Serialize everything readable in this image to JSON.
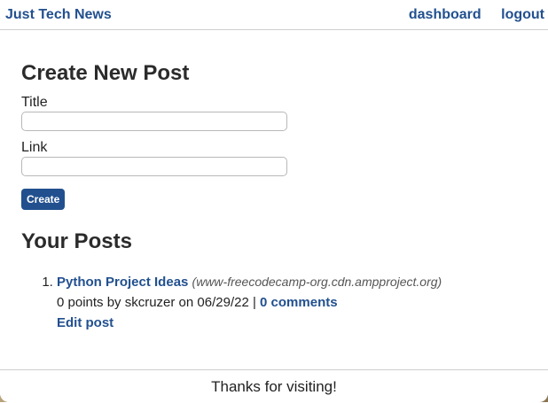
{
  "header": {
    "site_title": "Just Tech News",
    "nav": {
      "dashboard": "dashboard",
      "logout": "logout"
    }
  },
  "create_form": {
    "heading": "Create New Post",
    "title_label": "Title",
    "title_value": "",
    "link_label": "Link",
    "link_value": "",
    "submit_label": "Create"
  },
  "posts": {
    "heading": "Your Posts",
    "items": [
      {
        "title": "Python Project Ideas",
        "url": "(www-freecodecamp-org.cdn.ampproject.org)",
        "meta_prefix": "0 points by skcruzer on 06/29/22 |",
        "comments": "0 comments",
        "edit": "Edit post"
      }
    ]
  },
  "footer": {
    "text": "Thanks for visiting!"
  },
  "colors": {
    "accent": "#22508f",
    "text": "#222222",
    "border": "#cfcfcf"
  }
}
